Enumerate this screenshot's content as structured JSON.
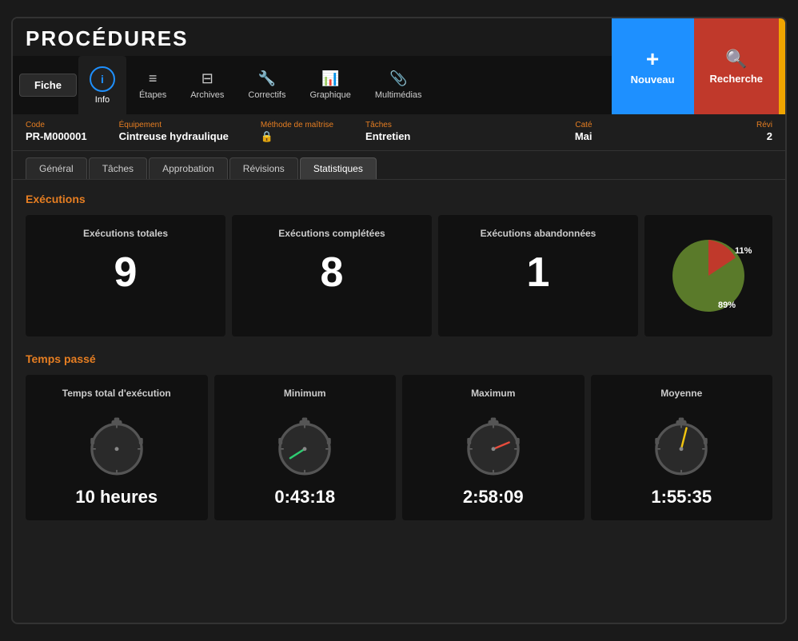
{
  "app": {
    "title": "PROCÉDURES",
    "window_border": "#333"
  },
  "header": {
    "nav_tabs": [
      {
        "id": "fiche",
        "label": "Fiche",
        "icon": "",
        "active": false,
        "is_fiche": true
      },
      {
        "id": "info",
        "label": "Info",
        "icon": "ℹ",
        "active": true
      },
      {
        "id": "etapes",
        "label": "Étapes",
        "icon": "≡",
        "active": false
      },
      {
        "id": "archives",
        "label": "Archives",
        "icon": "⊟",
        "active": false
      },
      {
        "id": "correctifs",
        "label": "Correctifs",
        "icon": "✕",
        "active": false
      },
      {
        "id": "graphique",
        "label": "Graphique",
        "icon": "📈",
        "active": false
      },
      {
        "id": "multimedias",
        "label": "Multimédias",
        "icon": "🔗",
        "active": false
      }
    ],
    "btn_nouveau": {
      "label": "Nouveau",
      "plus": "+"
    },
    "btn_recherche": {
      "label": "Recherche",
      "icon": "🔍"
    }
  },
  "record": {
    "code_label": "Code",
    "code_value": "PR-M000001",
    "equipement_label": "Équipement",
    "equipement_value": "Cintreuse hydraulique",
    "methode_label": "Méthode de maîtrise",
    "taches_label": "Tâches",
    "taches_value": "Entretien",
    "categorie_label": "Caté",
    "categorie_value": "Mai",
    "revision_label": "Révi",
    "revision_value": "2"
  },
  "sub_tabs": [
    {
      "id": "general",
      "label": "Général",
      "active": false
    },
    {
      "id": "taches",
      "label": "Tâches",
      "active": false
    },
    {
      "id": "approbation",
      "label": "Approbation",
      "active": false
    },
    {
      "id": "revisions",
      "label": "Révisions",
      "active": false
    },
    {
      "id": "statistiques",
      "label": "Statistiques",
      "active": true
    }
  ],
  "executions": {
    "section_title": "Exécutions",
    "total_label": "Exécutions totales",
    "total_value": "9",
    "completed_label": "Exécutions complétées",
    "completed_value": "8",
    "abandoned_label": "Exécutions abandonnées",
    "abandoned_value": "1",
    "pie": {
      "completed_pct": 89,
      "abandoned_pct": 11,
      "completed_label": "89%",
      "abandoned_label": "11%",
      "completed_color": "#5a7a2a",
      "abandoned_color": "#c0392b"
    }
  },
  "temps_passe": {
    "section_title": "Temps passé",
    "cards": [
      {
        "id": "total",
        "label": "Temps total d'exécution",
        "value": "10 heures",
        "needle_color": "#888",
        "needle_angle": 0
      },
      {
        "id": "minimum",
        "label": "Minimum",
        "value": "0:43:18",
        "needle_color": "#2ecc71",
        "needle_angle": -60
      },
      {
        "id": "maximum",
        "label": "Maximum",
        "value": "2:58:09",
        "needle_color": "#e74c3c",
        "needle_angle": 50
      },
      {
        "id": "moyenne",
        "label": "Moyenne",
        "value": "1:55:35",
        "needle_color": "#f1c40f",
        "needle_angle": 10
      }
    ]
  }
}
